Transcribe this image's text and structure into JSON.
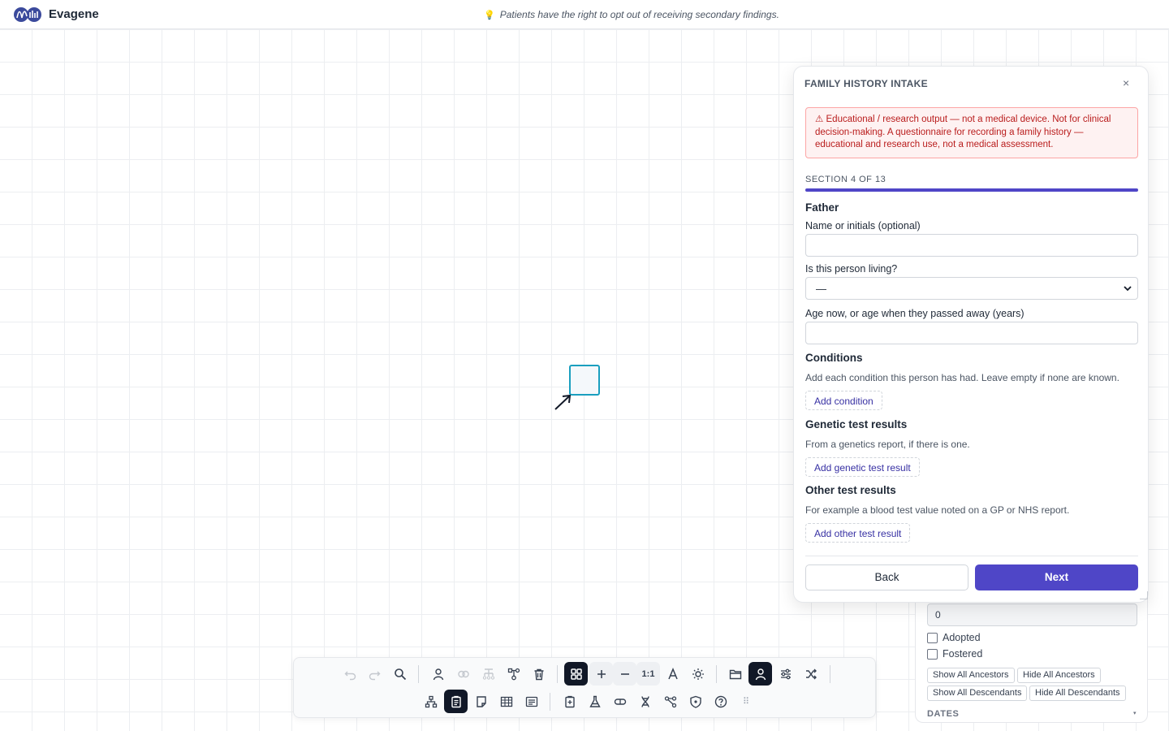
{
  "app": {
    "name": "Evagene",
    "banner_icon": "lightbulb-icon",
    "banner_text": "Patients have the right to opt out of receiving secondary findings."
  },
  "canvas": {
    "node_shape": "square",
    "node_color": "#1a9fbf"
  },
  "side_panel": {
    "field_value": "0",
    "checkboxes": [
      {
        "label": "Adopted",
        "checked": false
      },
      {
        "label": "Fostered",
        "checked": false
      }
    ],
    "buttons": [
      "Show All Ancestors",
      "Hide All Ancestors",
      "Show All Descendants",
      "Hide All Descendants"
    ],
    "section_label": "DATES",
    "section_caret": "▾"
  },
  "dialog": {
    "title": "FAMILY HISTORY INTAKE",
    "close_glyph": "×",
    "warning": "⚠ Educational / research output — not a medical device. Not for clinical decision-making. A questionnaire for recording a family history — educational and research use, not a medical assessment.",
    "section_counter": "SECTION 4 OF 13",
    "progress_fraction": 1.0,
    "person_heading": "Father",
    "fields": {
      "name_label": "Name or initials (optional)",
      "name_value": "",
      "living_label": "Is this person living?",
      "living_value": "—",
      "age_label": "Age now, or age when they passed away (years)",
      "age_value": ""
    },
    "conditions": {
      "heading": "Conditions",
      "help": "Add each condition this person has had. Leave empty if none are known.",
      "button": "Add condition"
    },
    "genetic": {
      "heading": "Genetic test results",
      "help": "From a genetics report, if there is one.",
      "button": "Add genetic test result"
    },
    "other": {
      "heading": "Other test results",
      "help": "For example a blood test value noted on a GP or NHS report.",
      "button": "Add other test result"
    },
    "back_label": "Back",
    "next_label": "Next",
    "accent": "#4f46c7"
  },
  "toolbar": {
    "zoom_reset_label": "1:1",
    "row1": [
      "undo-icon",
      "redo-icon",
      "search-icon",
      "add-person-icon",
      "link-icon",
      "add-children-icon",
      "family-icon",
      "trash-icon",
      "grid-icon",
      "zoom-in-icon",
      "zoom-out-icon",
      "zoom-reset",
      "text-icon",
      "sun-icon",
      "folder-icon",
      "person-icon",
      "sliders-icon",
      "shuffle-icon"
    ],
    "row2": [
      "tree-icon",
      "clipboard-icon",
      "note-icon",
      "table-icon",
      "list-icon",
      "report-icon",
      "flask-icon",
      "capsule-icon",
      "dna-icon",
      "share-icon",
      "shield-icon",
      "help-icon",
      "grip-icon"
    ]
  }
}
